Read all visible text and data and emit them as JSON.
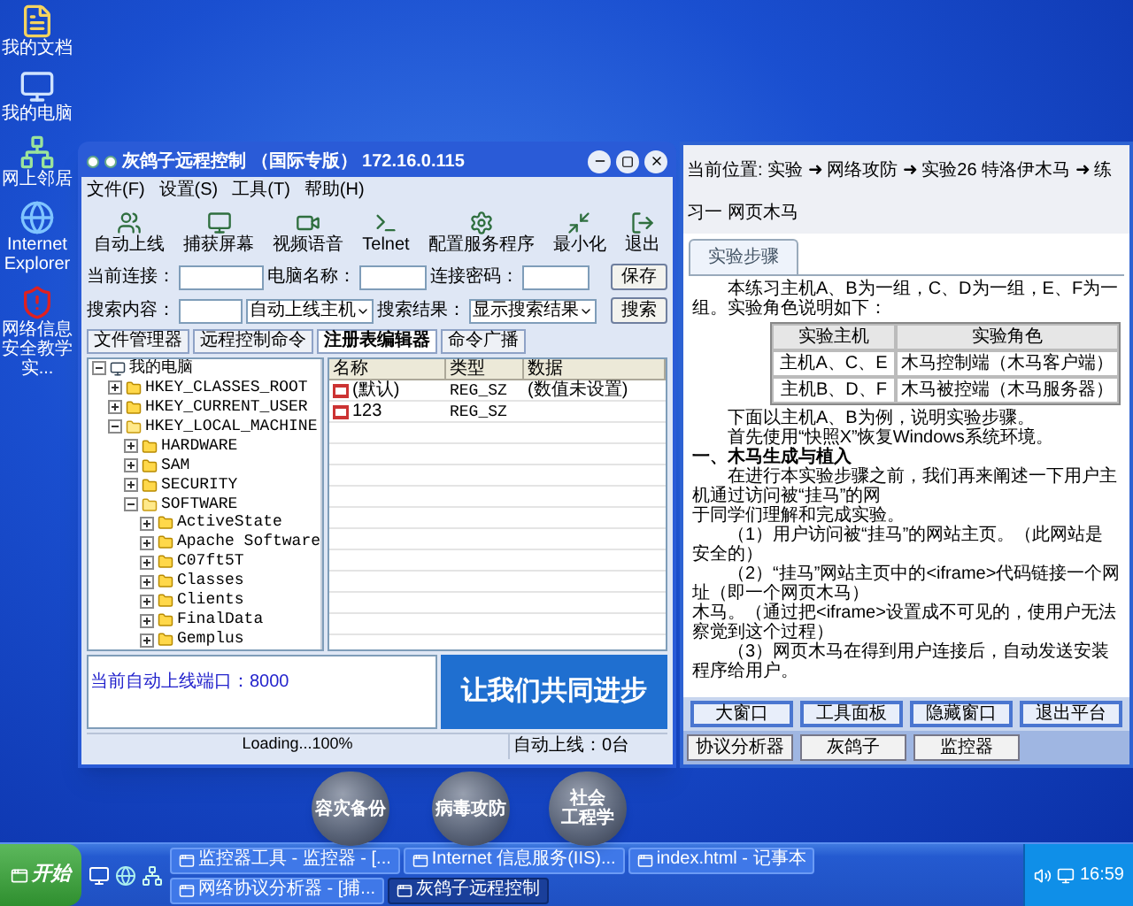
{
  "desktop_icons": [
    {
      "label": "我的文档"
    },
    {
      "label": "我的电脑"
    },
    {
      "label": "网上邻居"
    },
    {
      "label": "Internet Explorer"
    },
    {
      "label": "网络信息安全教学实..."
    }
  ],
  "remote_window": {
    "title": "灰鸽子远程控制 （国际专版） 172.16.0.115",
    "menu": [
      "文件(F)",
      "设置(S)",
      "工具(T)",
      "帮助(H)"
    ],
    "toolbar": [
      "自动上线",
      "捕获屏幕",
      "视频语音",
      "Telnet",
      "配置服务程序",
      "最小化",
      "退出"
    ],
    "connection_label": "当前连接：",
    "computer_label": "电脑名称：",
    "password_label": "连接密码：",
    "save_button": "保存",
    "search_label": "搜索内容：",
    "host_select": "自动上线主机",
    "result_label": "搜索结果：",
    "result_select": "显示搜索结果",
    "search_button": "搜索",
    "tabs": [
      {
        "label": "文件管理器",
        "selected": false
      },
      {
        "label": "远程控制命令",
        "selected": false
      },
      {
        "label": "注册表编辑器",
        "selected": true
      },
      {
        "label": "命令广播",
        "selected": false
      }
    ],
    "tree": [
      {
        "label": "我的电脑",
        "expanded": true,
        "children": [
          {
            "label": "HKEY_CLASSES_ROOT",
            "expanded": false
          },
          {
            "label": "HKEY_CURRENT_USER",
            "expanded": false
          },
          {
            "label": "HKEY_LOCAL_MACHINE",
            "expanded": true,
            "children": [
              {
                "label": "HARDWARE",
                "expanded": false
              },
              {
                "label": "SAM",
                "expanded": false
              },
              {
                "label": "SECURITY",
                "expanded": false
              },
              {
                "label": "SOFTWARE",
                "expanded": true,
                "children": [
                  {
                    "label": "ActiveState",
                    "expanded": false
                  },
                  {
                    "label": "Apache Software",
                    "expanded": false
                  },
                  {
                    "label": "C07ft5T",
                    "expanded": false
                  },
                  {
                    "label": "Classes",
                    "expanded": false
                  },
                  {
                    "label": "Clients",
                    "expanded": false
                  },
                  {
                    "label": "FinalData",
                    "expanded": false
                  },
                  {
                    "label": "Gemplus",
                    "expanded": false
                  }
                ]
              }
            ]
          }
        ]
      }
    ],
    "columns": [
      "名称",
      "类型",
      "数据"
    ],
    "values": [
      {
        "name": "(默认)",
        "type": "REG_SZ",
        "data": "(数值未设置)"
      },
      {
        "name": "123",
        "type": "REG_SZ"
      }
    ],
    "log": "当前自动上线端口：8000",
    "banner": "让我们共同进步",
    "status": "Loading...100%",
    "online": "自动上线：0台"
  },
  "lab_window": {
    "breadcrumb": "当前位置: 实验 ➜ 网络攻防 ➜ 实验26 特洛伊木马 ➜ 练习一 网页木马",
    "tab": "实验步骤",
    "intro": "本练习主机A、B为一组，C、D为一组，E、F为一组。实验角色说明如下：",
    "table": {
      "columns": [
        "实验主机",
        "实验角色"
      ],
      "rows": [
        [
          "主机A、C、E",
          "木马控制端（木马客户端）"
        ],
        [
          "主机B、D、F",
          "木马被控端（木马服务器）"
        ]
      ]
    },
    "paragraphs": [
      {
        "kind": "indent",
        "text": "下面以主机A、B为例，说明实验步骤。"
      },
      {
        "kind": "indent",
        "text": "首先使用“快照X”恢复Windows系统环境。"
      },
      {
        "kind": "heading",
        "text": "一、木马生成与植入"
      },
      {
        "kind": "indent",
        "text": "在进行本实验步骤之前，我们再来阐述一下用户主机通过访问被“挂马”的网"
      },
      {
        "kind": "plain",
        "text": "于同学们理解和完成实验。"
      },
      {
        "kind": "indent",
        "text": "（1）用户访问被“挂马”的网站主页。（此网站是安全的）"
      },
      {
        "kind": "indent",
        "text": "（2）“挂马”网站主页中的<iframe>代码链接一个网址（即一个网页木马）"
      },
      {
        "kind": "plain",
        "text": "木马。（通过把<iframe>设置成不可见的，使用户无法察觉到这个过程）"
      },
      {
        "kind": "indent",
        "text": "（3）网页木马在得到用户连接后，自动发送安装程序给用户。"
      }
    ],
    "buttons": [
      "大窗口",
      "工具面板",
      "隐藏窗口",
      "退出平台"
    ],
    "tools": [
      "协议分析器",
      "灰鸽子",
      "监控器"
    ]
  },
  "bubbles": [
    {
      "lines": [
        "容灾备份"
      ]
    },
    {
      "lines": [
        "病毒攻防"
      ]
    },
    {
      "lines": [
        "社会",
        "工程学"
      ]
    }
  ],
  "taskbar": {
    "start": "开始",
    "tasks": [
      {
        "label": "监控器工具 - 监控器 - [...",
        "selected": false
      },
      {
        "label": "Internet 信息服务(IIS)...",
        "selected": false
      },
      {
        "label": "index.html - 记事本",
        "selected": false
      },
      {
        "label": "网络协议分析器 - [捕...",
        "selected": false
      },
      {
        "label": "灰鸽子远程控制",
        "selected": true
      }
    ],
    "time": "16:59"
  }
}
